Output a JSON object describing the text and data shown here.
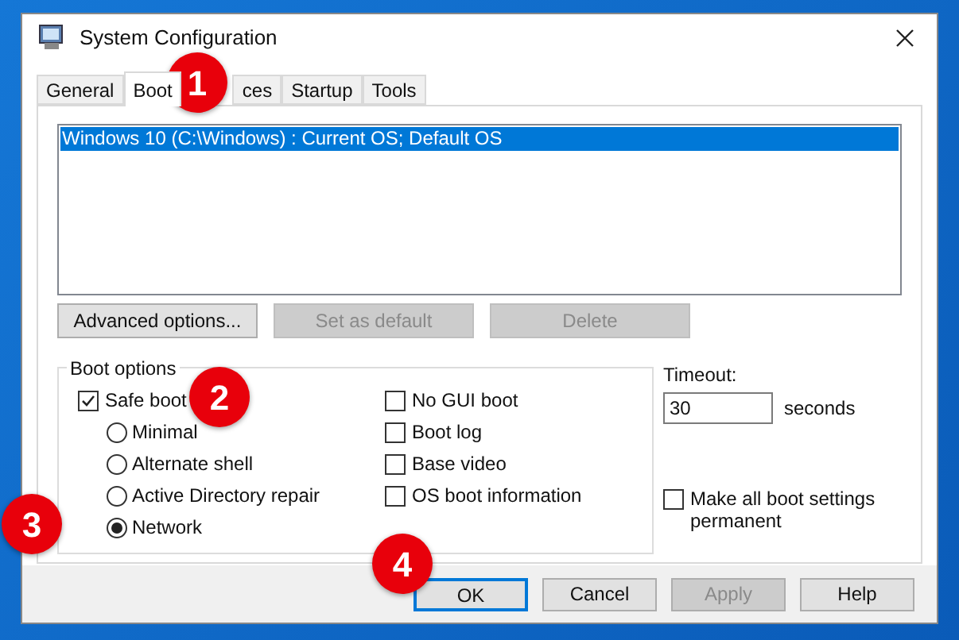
{
  "window": {
    "title": "System Configuration"
  },
  "tabs": [
    {
      "label": "General",
      "selected": false
    },
    {
      "label": "Boot",
      "selected": true
    },
    {
      "label": "ces",
      "selected": false
    },
    {
      "label": "Startup",
      "selected": false
    },
    {
      "label": "Tools",
      "selected": false
    }
  ],
  "boot_entries": [
    {
      "text": "Windows 10 (C:\\Windows) : Current OS; Default OS",
      "selected": true
    }
  ],
  "entry_buttons": [
    {
      "label": "Advanced options...",
      "disabled": false
    },
    {
      "label": "Set as default",
      "disabled": true
    },
    {
      "label": "Delete",
      "disabled": true
    }
  ],
  "boot_options": {
    "title": "Boot options",
    "safe_boot": {
      "label": "Safe boot",
      "checked": true
    },
    "modes": [
      {
        "label": "Minimal",
        "selected": false
      },
      {
        "label": "Alternate shell",
        "selected": false
      },
      {
        "label": "Active Directory repair",
        "selected": false
      },
      {
        "label": "Network",
        "selected": true
      }
    ],
    "flags": [
      {
        "label": "No GUI boot",
        "checked": false
      },
      {
        "label": "Boot log",
        "checked": false
      },
      {
        "label": "Base video",
        "checked": false
      },
      {
        "label": "OS boot information",
        "checked": false
      }
    ]
  },
  "timeout": {
    "label": "Timeout:",
    "value": "30",
    "unit": "seconds"
  },
  "make_permanent": {
    "label": "Make all boot settings permanent",
    "checked": false
  },
  "buttons": [
    {
      "label": "OK",
      "disabled": false,
      "default": true
    },
    {
      "label": "Cancel",
      "disabled": false,
      "default": false
    },
    {
      "label": "Apply",
      "disabled": true,
      "default": false
    },
    {
      "label": "Help",
      "disabled": false,
      "default": false
    }
  ],
  "callouts": [
    "1",
    "2",
    "3",
    "4"
  ]
}
